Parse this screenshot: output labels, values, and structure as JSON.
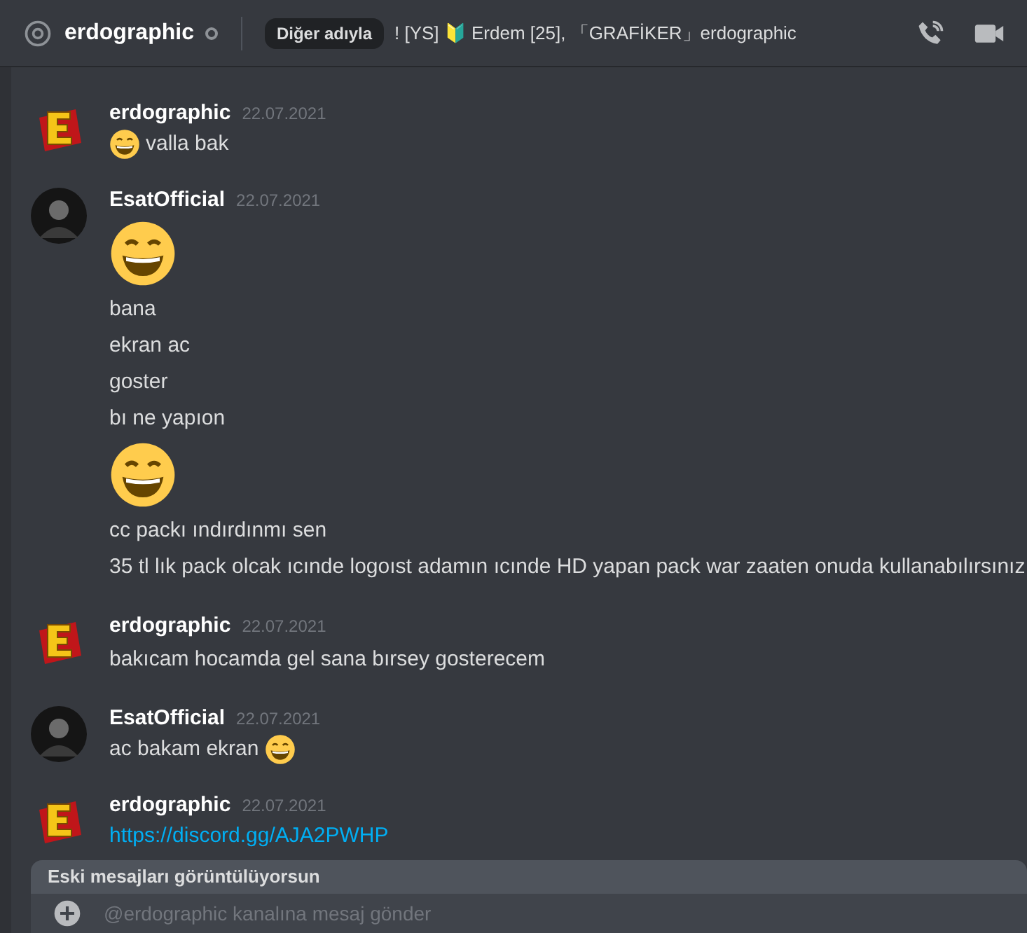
{
  "header": {
    "channel": "erdographic",
    "tag": "Diğer adıyla",
    "aka": "! [YS] 🔰 Erdem [25], 「GRAFİKER」erdographic"
  },
  "messages": [
    {
      "author": "erdographic",
      "avatar": {
        "kind": "emblem"
      },
      "date": "22.07.2021",
      "lines": [
        {
          "kind": "inline",
          "parts": [
            {
              "kind": "emoji"
            },
            {
              "kind": "text",
              "text": "valla bak"
            }
          ]
        }
      ]
    },
    {
      "author": "EsatOfficial",
      "avatar": {
        "kind": "person"
      },
      "date": "22.07.2021",
      "lines": [
        {
          "kind": "jumbo"
        },
        {
          "kind": "plain",
          "text": "bana"
        },
        {
          "kind": "plain",
          "text": "ekran ac"
        },
        {
          "kind": "plain",
          "text": "goster"
        },
        {
          "kind": "plain",
          "text": "bı ne yapıon"
        },
        {
          "kind": "jumbo"
        },
        {
          "kind": "plain",
          "text": "cc packı ındırdınmı sen"
        },
        {
          "kind": "plain",
          "text": "35 tl lık pack olcak ıcınde logoıst adamın ıcınde HD yapan pack war zaaten onuda kullanabılırsınız"
        }
      ]
    },
    {
      "author": "erdographic",
      "avatar": {
        "kind": "emblem"
      },
      "date": "22.07.2021",
      "lines": [
        {
          "kind": "plain",
          "text": "bakıcam hocamda gel sana bırsey gosterecem"
        }
      ]
    },
    {
      "author": "EsatOfficial",
      "avatar": {
        "kind": "person"
      },
      "date": "22.07.2021",
      "lines": [
        {
          "kind": "inline",
          "parts": [
            {
              "kind": "text",
              "text": "ac bakam ekran"
            },
            {
              "kind": "emoji"
            }
          ]
        }
      ]
    },
    {
      "author": "erdographic",
      "avatar": {
        "kind": "emblem"
      },
      "date": "22.07.2021",
      "lines": [
        {
          "kind": "link",
          "text": "https://discord.gg/AJA2PWHP"
        }
      ]
    }
  ],
  "banner": "Eski mesajları görüntülüyorsun",
  "composer": {
    "placeholder": "@erdographic kanalına mesaj gönder"
  }
}
